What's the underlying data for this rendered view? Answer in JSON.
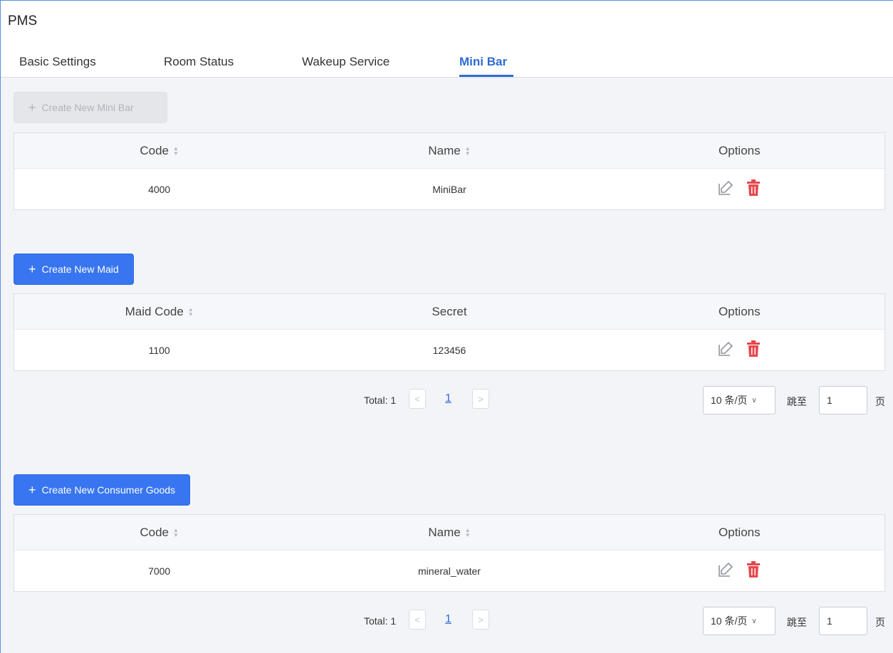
{
  "page": {
    "title": "PMS"
  },
  "tabs": [
    {
      "label": "Basic Settings"
    },
    {
      "label": "Room Status"
    },
    {
      "label": "Wakeup Service"
    },
    {
      "label": "Mini Bar",
      "active": true
    }
  ],
  "minibar": {
    "create_label": "Create New Mini Bar",
    "columns": [
      "Code",
      "Name",
      "Options"
    ],
    "rows": [
      {
        "code": "4000",
        "name": "MiniBar"
      }
    ]
  },
  "maid": {
    "create_label": "Create New Maid",
    "columns": [
      "Maid Code",
      "Secret",
      "Options"
    ],
    "rows": [
      {
        "code": "1100",
        "secret": "123456"
      }
    ],
    "pager": {
      "total": "Total: 1",
      "page": "1",
      "page_size": "10 条/页",
      "jump": "跳至",
      "jump_value": "1",
      "page_unit": "页"
    }
  },
  "goods": {
    "create_label": "Create New Consumer Goods",
    "columns": [
      "Code",
      "Name",
      "Options"
    ],
    "rows": [
      {
        "code": "7000",
        "name": "mineral_water"
      }
    ],
    "pager": {
      "total": "Total: 1",
      "page": "1",
      "page_size": "10 条/页",
      "jump": "跳至",
      "jump_value": "1",
      "page_unit": "页"
    }
  },
  "colors": {
    "accent": "#2f6bd8",
    "primary_button": "#3875f0",
    "delete": "#e5484d",
    "edit": "#8f959e"
  },
  "icons": {
    "plus": "plus-icon",
    "sort": "sort-icon",
    "edit": "edit-icon",
    "delete": "trash-icon",
    "prev": "chevron-left-icon",
    "next": "chevron-right-icon",
    "dropdown": "chevron-down-icon"
  }
}
